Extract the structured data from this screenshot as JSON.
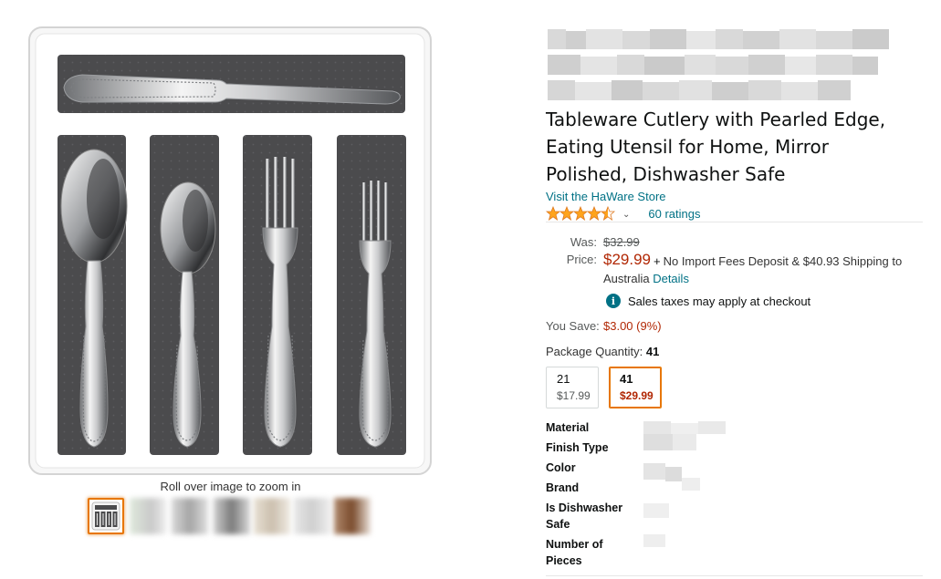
{
  "product": {
    "title": "Tableware Cutlery with Pearled Edge, Eating Utensil for Home, Mirror Polished, Dishwasher Safe",
    "store_link": "Visit the HaWare Store",
    "rating_stars": 4.5,
    "ratings_count": "60 ratings"
  },
  "image_area": {
    "zoom_hint": "Roll over image to zoom in",
    "thumbnail_count": 7,
    "selected_thumbnail": 1
  },
  "pricing": {
    "was_label": "Was:",
    "was_value": "$32.99",
    "price_label": "Price:",
    "price_value": "$29.99",
    "price_extra_plus": "+",
    "price_extra": "No Import Fees Deposit & $40.93 Shipping to",
    "price_extra_line2": "Australia ",
    "details_link": "Details",
    "tax_icon": "i",
    "tax_note": "Sales taxes may apply at checkout",
    "save_label": "You Save:",
    "save_value": "$3.00 (9%)"
  },
  "package": {
    "label": "Package Quantity: ",
    "selected": "41",
    "options": [
      {
        "name": "21",
        "price": "$17.99"
      },
      {
        "name": "41",
        "price": "$29.99"
      }
    ]
  },
  "specs": [
    {
      "label": "Material"
    },
    {
      "label": "Finish Type"
    },
    {
      "label": "Color"
    },
    {
      "label": "Brand"
    },
    {
      "label": "Is Dishwasher Safe"
    },
    {
      "label": "Number of Pieces"
    }
  ],
  "colors": {
    "link": "#007185",
    "price": "#b12704",
    "star": "#ffa41c",
    "selected_border": "#e77600",
    "tray_white": "#f6f6f6",
    "tray_grey": "#4a4a4c"
  }
}
